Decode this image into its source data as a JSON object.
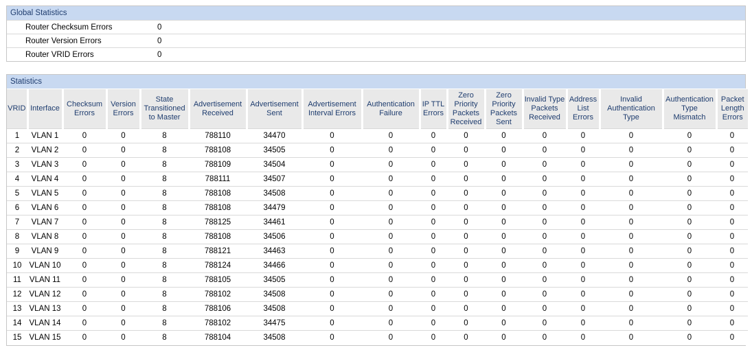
{
  "colors": {
    "section_header_bg": "#c8d9f1",
    "section_header_text": "#1e3c6e",
    "table_header_bg": "#e9e9e9",
    "row_border": "#d9d9d9",
    "section_border": "#c6c6c6",
    "data_text": "#000000"
  },
  "global_statistics": {
    "title": "Global Statistics",
    "rows": [
      {
        "label": "Router Checksum Errors",
        "value": "0"
      },
      {
        "label": "Router Version Errors",
        "value": "0"
      },
      {
        "label": "Router VRID Errors",
        "value": "0"
      }
    ]
  },
  "statistics": {
    "title": "Statistics",
    "columns": [
      "VRID",
      "Interface",
      "Checksum Errors",
      "Version Errors",
      "State Transitioned to Master",
      "Advertisement Received",
      "Advertisement Sent",
      "Advertisement Interval Errors",
      "Authentication Failure",
      "IP TTL Errors",
      "Zero Priority Packets Received",
      "Zero Priority Packets Sent",
      "Invalid Type Packets Received",
      "Address List Errors",
      "Invalid Authentication Type",
      "Authentication Type Mismatch",
      "Packet Length Errors"
    ],
    "rows": [
      [
        "1",
        "VLAN 1",
        "0",
        "0",
        "8",
        "788110",
        "34470",
        "0",
        "0",
        "0",
        "0",
        "0",
        "0",
        "0",
        "0",
        "0",
        "0"
      ],
      [
        "2",
        "VLAN 2",
        "0",
        "0",
        "8",
        "788108",
        "34505",
        "0",
        "0",
        "0",
        "0",
        "0",
        "0",
        "0",
        "0",
        "0",
        "0"
      ],
      [
        "3",
        "VLAN 3",
        "0",
        "0",
        "8",
        "788109",
        "34504",
        "0",
        "0",
        "0",
        "0",
        "0",
        "0",
        "0",
        "0",
        "0",
        "0"
      ],
      [
        "4",
        "VLAN 4",
        "0",
        "0",
        "8",
        "788111",
        "34507",
        "0",
        "0",
        "0",
        "0",
        "0",
        "0",
        "0",
        "0",
        "0",
        "0"
      ],
      [
        "5",
        "VLAN 5",
        "0",
        "0",
        "8",
        "788108",
        "34508",
        "0",
        "0",
        "0",
        "0",
        "0",
        "0",
        "0",
        "0",
        "0",
        "0"
      ],
      [
        "6",
        "VLAN 6",
        "0",
        "0",
        "8",
        "788108",
        "34479",
        "0",
        "0",
        "0",
        "0",
        "0",
        "0",
        "0",
        "0",
        "0",
        "0"
      ],
      [
        "7",
        "VLAN 7",
        "0",
        "0",
        "8",
        "788125",
        "34461",
        "0",
        "0",
        "0",
        "0",
        "0",
        "0",
        "0",
        "0",
        "0",
        "0"
      ],
      [
        "8",
        "VLAN 8",
        "0",
        "0",
        "8",
        "788108",
        "34506",
        "0",
        "0",
        "0",
        "0",
        "0",
        "0",
        "0",
        "0",
        "0",
        "0"
      ],
      [
        "9",
        "VLAN 9",
        "0",
        "0",
        "8",
        "788121",
        "34463",
        "0",
        "0",
        "0",
        "0",
        "0",
        "0",
        "0",
        "0",
        "0",
        "0"
      ],
      [
        "10",
        "VLAN 10",
        "0",
        "0",
        "8",
        "788124",
        "34466",
        "0",
        "0",
        "0",
        "0",
        "0",
        "0",
        "0",
        "0",
        "0",
        "0"
      ],
      [
        "11",
        "VLAN 11",
        "0",
        "0",
        "8",
        "788105",
        "34505",
        "0",
        "0",
        "0",
        "0",
        "0",
        "0",
        "0",
        "0",
        "0",
        "0"
      ],
      [
        "12",
        "VLAN 12",
        "0",
        "0",
        "8",
        "788102",
        "34508",
        "0",
        "0",
        "0",
        "0",
        "0",
        "0",
        "0",
        "0",
        "0",
        "0"
      ],
      [
        "13",
        "VLAN 13",
        "0",
        "0",
        "8",
        "788106",
        "34508",
        "0",
        "0",
        "0",
        "0",
        "0",
        "0",
        "0",
        "0",
        "0",
        "0"
      ],
      [
        "14",
        "VLAN 14",
        "0",
        "0",
        "8",
        "788102",
        "34475",
        "0",
        "0",
        "0",
        "0",
        "0",
        "0",
        "0",
        "0",
        "0",
        "0"
      ],
      [
        "15",
        "VLAN 15",
        "0",
        "0",
        "8",
        "788104",
        "34508",
        "0",
        "0",
        "0",
        "0",
        "0",
        "0",
        "0",
        "0",
        "0",
        "0"
      ]
    ]
  }
}
